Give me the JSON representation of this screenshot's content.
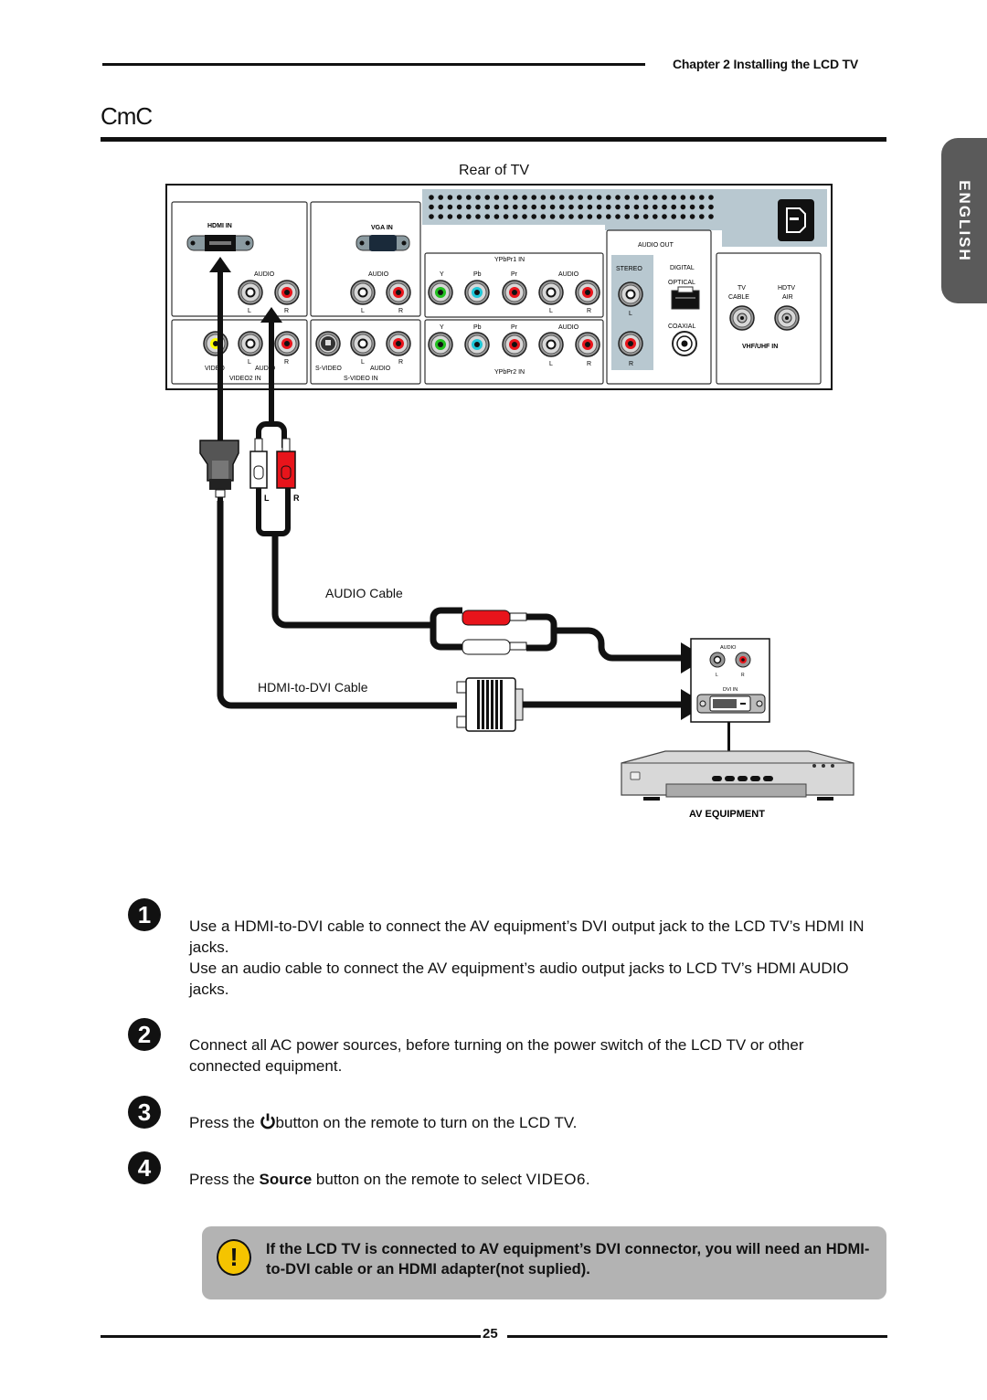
{
  "header": {
    "chapter": "Chapter 2 Installing the LCD TV",
    "section_title": "CmC",
    "language_tab": "ENGLISH"
  },
  "diagram": {
    "rear_label": "Rear of TV",
    "panel": {
      "hdmi_in": "HDMI IN",
      "vga_in": "VGA IN",
      "audio": "AUDIO",
      "l": "L",
      "r": "R",
      "video": "VIDEO",
      "video2_in": "VIDEO2 IN",
      "s_video": "S-VIDEO",
      "s_video_in": "S-VIDEO IN",
      "ypbpr1_in": "YPbPr1 IN",
      "ypbpr2_in": "YPbPr2 IN",
      "y": "Y",
      "pb": "Pb",
      "pr": "Pr",
      "audio_out": "AUDIO OUT",
      "stereo": "STEREO",
      "digital": "DIGITAL",
      "optical": "OPTICAL",
      "coaxial": "COAXIAL",
      "tv": "TV",
      "cable": "CABLE",
      "hdtv": "HDTV",
      "air": "AIR",
      "vhf_uhf_in": "VHF/UHF IN"
    },
    "audio_cable_label": "AUDIO Cable",
    "dvi_cable_label": "HDMI-to-DVI Cable",
    "plug_l": "L",
    "plug_r": "R",
    "device": {
      "audio": "AUDIO",
      "l": "L",
      "r": "R",
      "dvi_in": "DVI IN",
      "name": "AV EQUIPMENT"
    },
    "colors": {
      "panel_gray": "#b8c8d0",
      "jack_red": "#e8141b",
      "jack_green": "#22c020",
      "jack_cyan": "#20c8d8",
      "jack_yellow": "#ffff00"
    }
  },
  "steps": [
    {
      "number": "1",
      "paragraphs": [
        "Use a HDMI-to-DVI cable to connect the AV equipment’s DVI output jack to the LCD TV’s HDMI IN jacks.",
        "Use an audio cable to connect the AV equipment’s audio output jacks to LCD TV’s HDMI AUDIO jacks."
      ]
    },
    {
      "number": "2",
      "paragraphs": [
        "Connect all AC power sources, before turning on the power switch of the LCD TV or other connected equipment."
      ]
    },
    {
      "number": "3",
      "pre": "Press the ",
      "icon": "power-icon",
      "post": "button on the remote to turn on the LCD TV."
    },
    {
      "number": "4",
      "pre": "Press the ",
      "bold1": "Source",
      "mid": " button on the remote to select ",
      "bold2": "VIDEO6",
      "post": "."
    }
  ],
  "note": {
    "icon": "warning-icon",
    "glyph": "!",
    "text": "If the LCD TV is connected to AV equipment’s DVI connector,  you will need an HDMI-to-DVI cable or  an HDMI adapter(not suplied)."
  },
  "footer": {
    "page_number": "25"
  }
}
